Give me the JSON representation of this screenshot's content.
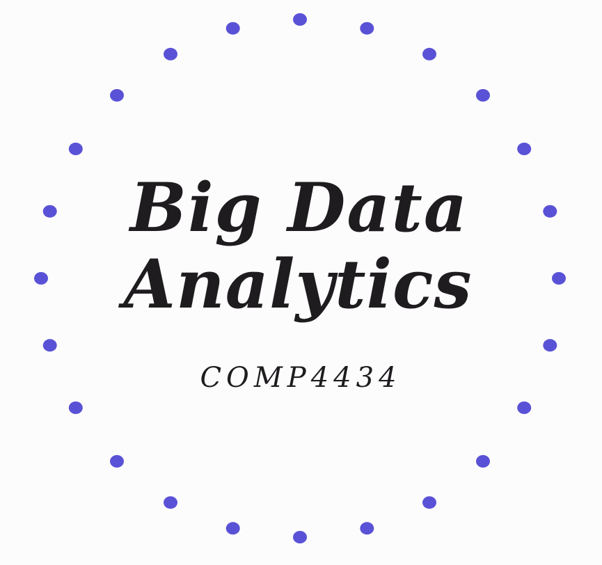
{
  "logo": {
    "title_line_1": "Big Data",
    "title_line_2": "Analytics",
    "course_code": "COMP4434",
    "dot_ring": {
      "count": 24,
      "color": "#5a52d6"
    },
    "text_color": "#1e1c1e",
    "background_color": "#fdfcfd"
  }
}
